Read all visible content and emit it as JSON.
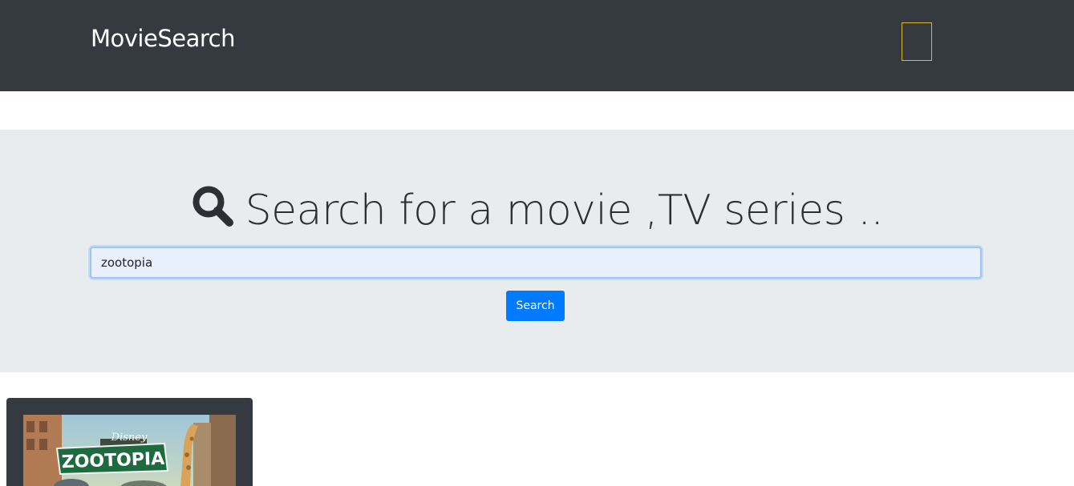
{
  "navbar": {
    "brand": "MovieSearch"
  },
  "search": {
    "heading": "Search for a movie ,TV series ..",
    "input_value": "zootopia",
    "button_label": "Search"
  },
  "results": [
    {
      "poster_brand": "Disney",
      "poster_title": "ZOOTOPIA"
    }
  ],
  "colors": {
    "navbar_bg": "#343a40",
    "jumbotron_bg": "#e9ecef",
    "primary": "#007bff",
    "toggler_border": "#d8b93a"
  },
  "icons": {
    "heading_icon": "search-icon",
    "toggler_icon": "menu-toggler-icon"
  }
}
